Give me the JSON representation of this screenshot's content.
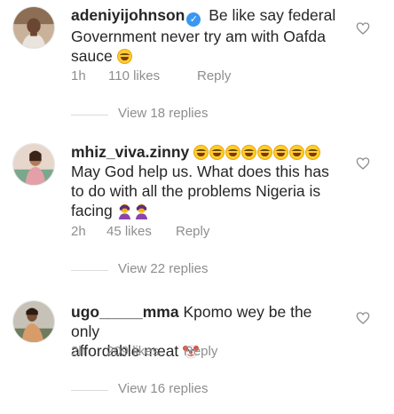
{
  "comments": [
    {
      "username": "adeniyijohnson",
      "verified": true,
      "text_line1": "Be like say federal",
      "text_line2": "Government never try am with Oafda",
      "text_line3": "sauce",
      "time": "1h",
      "likes": "110 likes",
      "reply": "Reply",
      "view_replies": "View 18 replies"
    },
    {
      "username": "mhiz_viva.zinny",
      "text_line1": "May God help us. What does this has",
      "text_line2": "to do with all the problems Nigeria is",
      "text_line3": "facing",
      "time": "2h",
      "likes": "45 likes",
      "reply": "Reply",
      "view_replies": "View 22 replies"
    },
    {
      "username": "ugo_____mma",
      "text_line1": "Kpomo wey be the only",
      "text_line2": "affordable meat",
      "time": "2h",
      "likes": "209 likes",
      "reply": "Reply",
      "view_replies": "View 16 replies"
    }
  ],
  "icons": {
    "like": "heart-outline-icon",
    "verified": "verified-badge-icon",
    "laugh": "face-with-tears-of-joy-emoji",
    "facepalm": "woman-facepalming-emoji",
    "clown": "clown-face-emoji"
  },
  "colors": {
    "text": "#262626",
    "secondary": "#8e8e8e",
    "verified": "#3897f0"
  }
}
